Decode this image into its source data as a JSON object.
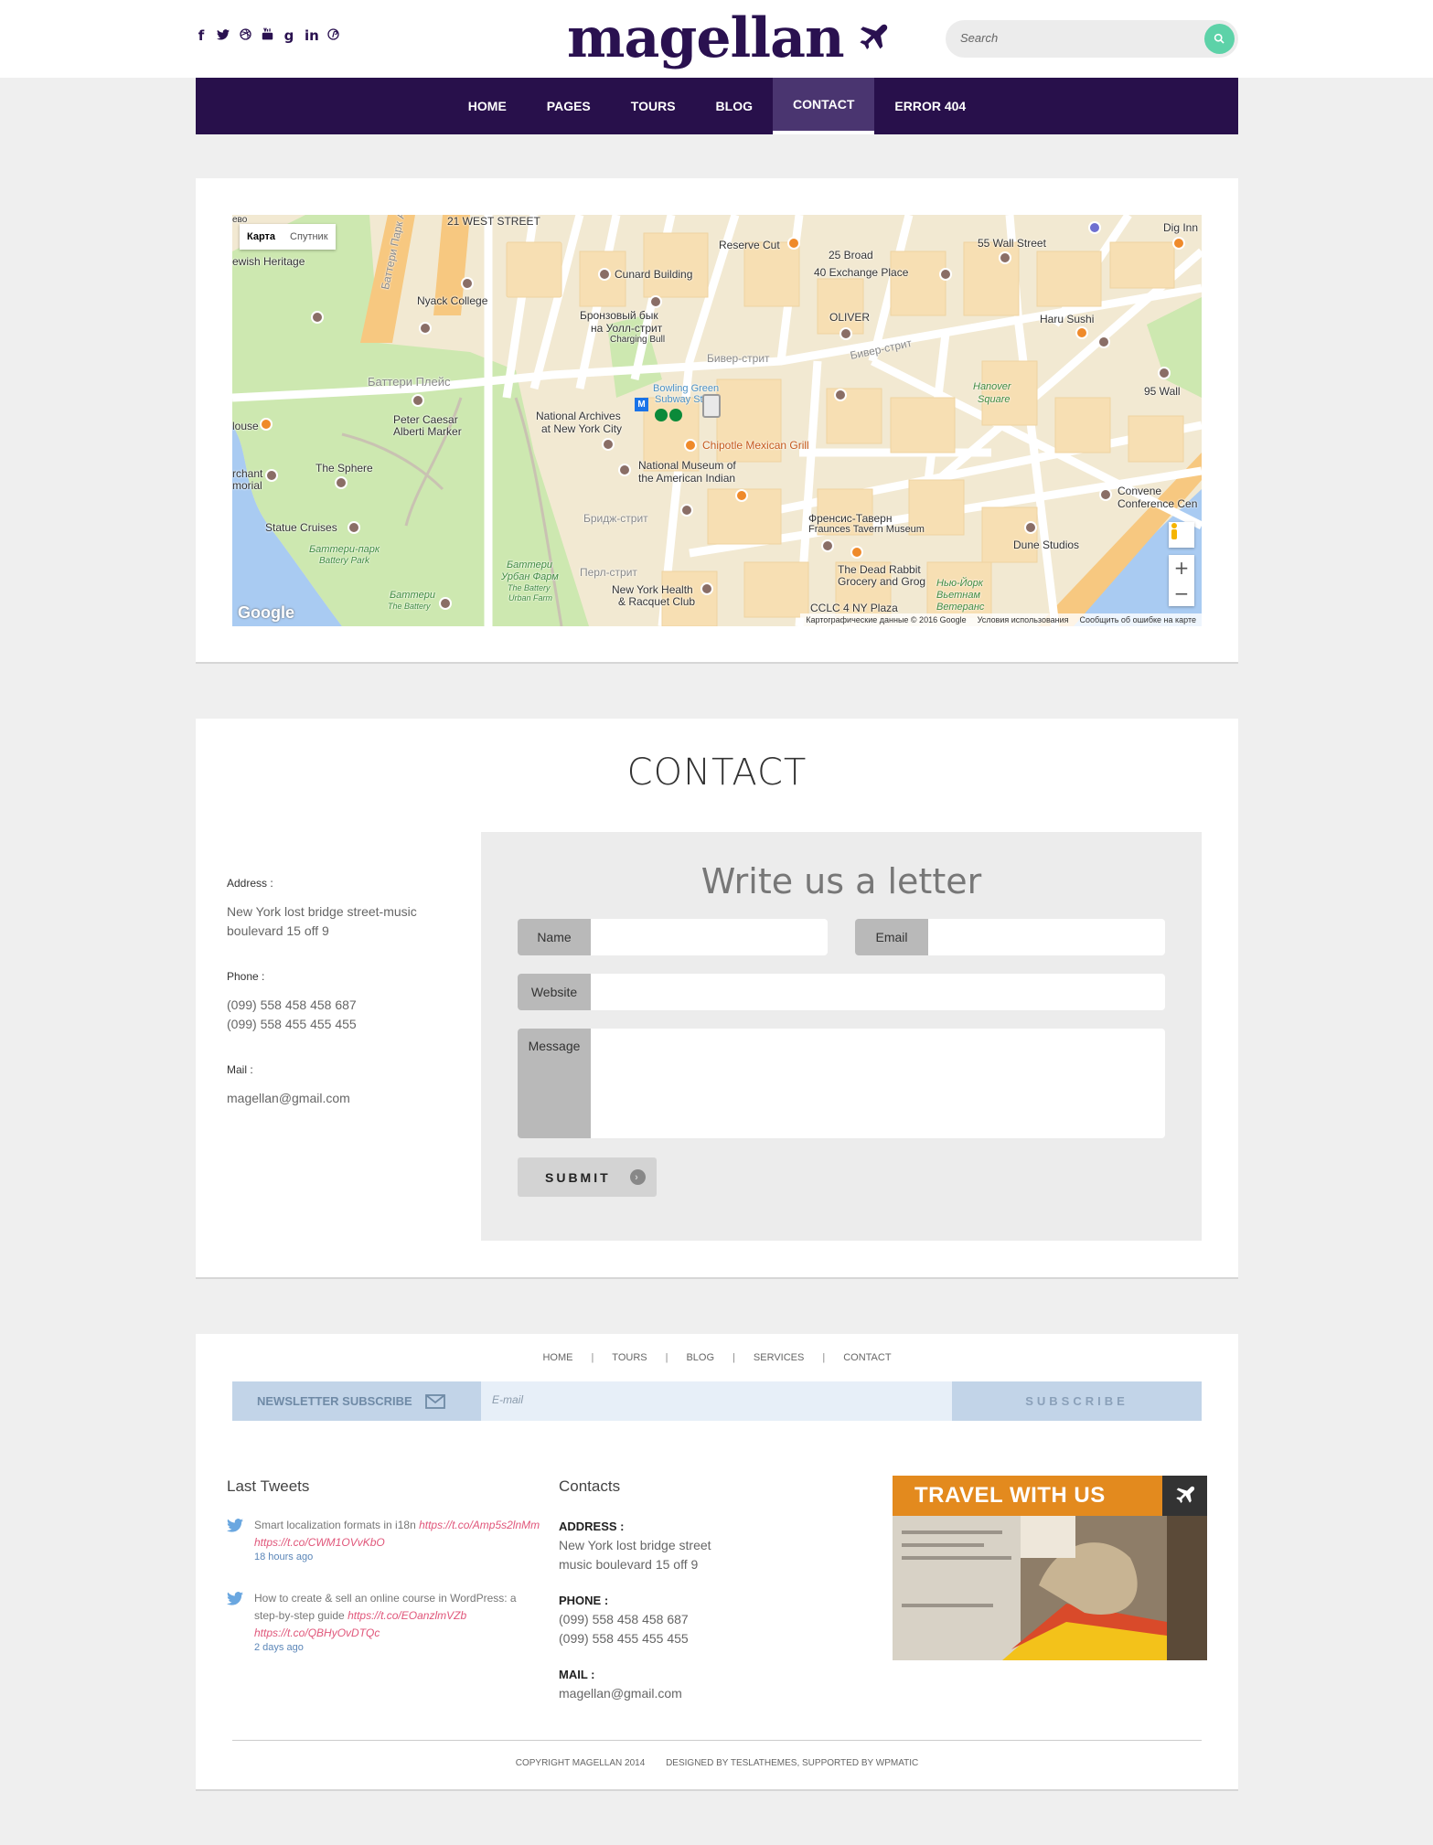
{
  "header": {
    "social_icons": [
      {
        "name": "facebook-icon",
        "glyph": "f"
      },
      {
        "name": "twitter-icon",
        "glyph": "🐦"
      },
      {
        "name": "dribbble-icon",
        "glyph": "⊛"
      },
      {
        "name": "youtube-icon",
        "glyph": "▶"
      },
      {
        "name": "google-plus-icon",
        "glyph": "g"
      },
      {
        "name": "linkedin-icon",
        "glyph": "in"
      },
      {
        "name": "pinterest-icon",
        "glyph": "℗"
      }
    ],
    "logo_text": "magellan",
    "search_placeholder": "Search"
  },
  "nav": {
    "items": [
      "HOME",
      "PAGES",
      "TOURS",
      "BLOG",
      "CONTACT",
      "ERROR 404"
    ],
    "active": "CONTACT"
  },
  "map": {
    "map_type": [
      "Карта",
      "Спутник"
    ],
    "google_logo": "Google",
    "footer": [
      "Картографические данные © 2016 Google",
      "Условия использования",
      "Сообщить об ошибке на карте"
    ],
    "labels": {
      "street1": "21 WEST STREET",
      "battery_park_andre": "Баттери Парк Андер",
      "cunard": "Cunard Building",
      "reserve_cut": "Reserve Cut",
      "broad25": "25 Broad",
      "exchange40": "40 Exchange Place",
      "wall55": "55 Wall Street",
      "dig_inn": "Dig Inn",
      "nyack": "Nyack College",
      "bull": "Бронзовый бык",
      "bull2": "на Уолл-стрит",
      "bull3": "Charging Bull",
      "oliver": "OLIVER",
      "haru": "Haru Sushi",
      "wall95": "95 Wall",
      "battery_place": "Баттери Плейс",
      "beaver1": "Бивер-стрит",
      "beaver2": "Бивер-стрит",
      "bowling": "Bowling Green",
      "subway": "Subway St",
      "hanover": "Hanover",
      "hanover2": "Square",
      "peter": "Peter Caesar",
      "peter2": "Alberti Marker",
      "archives": "National Archives",
      "archives2": "at New York City",
      "chipotle": "Chipotle Mexican Grill",
      "sphere": "The Sphere",
      "museum": "National Museum of",
      "museum2": "the American Indian",
      "convene": "Convene",
      "convene2": "Conference Cen",
      "statue": "Statue Cruises",
      "battery_park": "Баттери-парк",
      "battery_park2": "Battery Park",
      "bridge": "Бридж-стрит",
      "fraunces": "Френсис-Таверн",
      "fraunces2": "Fraunces Tavern Museum",
      "dune": "Dune Studios",
      "dead_rabbit": "The Dead Rabbit",
      "dead_rabbit2": "Grocery and Grog",
      "urban_farm": "Баттери",
      "urban_farm2": "Урбан Фарм",
      "urban_farm3": "The Battery",
      "urban_farm4": "Urban Farm",
      "pearl": "Перл-стрит",
      "health": "New York Health",
      "health2": "& Racquet Club",
      "vets": "Нью-Йорк",
      "vets2": "Вьетнам",
      "vets3": "Ветеранс",
      "cclc": "CCLC 4 NY Plaza",
      "battery_bottom": "Баттери",
      "battery_bottom2": "The Battery",
      "house": "louse",
      "merchant": "rchant",
      "merchant2": "morial",
      "heritage": "ewish Heritage",
      "nyu": "ево"
    }
  },
  "contact": {
    "title": "CONTACT",
    "address_label": "Address :",
    "address_lines": [
      "New York lost bridge street-music",
      "boulevard 15 off 9"
    ],
    "phone_label": "Phone :",
    "phone_lines": [
      "(099) 558 458 458 687",
      "(099) 558 455 455 455"
    ],
    "mail_label": "Mail :",
    "mail": "magellan@gmail.com",
    "form": {
      "title": "Write us a letter",
      "name_label": "Name",
      "email_label": "Email",
      "website_label": "Website",
      "message_label": "Message",
      "submit_label": "SUBMIT"
    }
  },
  "footer": {
    "nav": [
      "HOME",
      "TOURS",
      "BLOG",
      "SERVICES",
      "CONTACT"
    ],
    "newsletter_label": "NEWSLETTER SUBSCRIBE",
    "newsletter_placeholder": "E-mail",
    "subscribe_label": "SUBSCRIBE",
    "tweets_title": "Last Tweets",
    "tweets": [
      {
        "text": "Smart localization formats in i18n ",
        "links": "https://t.co/Amp5s2lnMm https://t.co/CWM1OVvKbO",
        "time": "18 hours ago"
      },
      {
        "text": "How to create & sell an online course in WordPress: a step-by-step guide ",
        "links": "https://t.co/EOanzlmVZb https://t.co/QBHyOvDTQc",
        "time": "2 days ago"
      }
    ],
    "contacts_title": "Contacts",
    "address_label": "ADDRESS :",
    "address_lines": [
      "New York lost bridge street",
      "music boulevard 15 off 9"
    ],
    "phone_label": "PHONE :",
    "phone_lines": [
      "(099) 558 458 458 687",
      "(099) 558 455 455 455"
    ],
    "mail_label": "MAIL :",
    "mail": "magellan@gmail.com",
    "promo_title": "TRAVEL WITH US",
    "copyright": "COPYRIGHT MAGELLAN 2014",
    "designed_by": "DESIGNED BY TESLATHEMES, SUPPORTED BY WPMATIC"
  },
  "colors": {
    "brand": "#28104b",
    "accent": "#5dd2a8",
    "promo": "#e38a1e"
  }
}
